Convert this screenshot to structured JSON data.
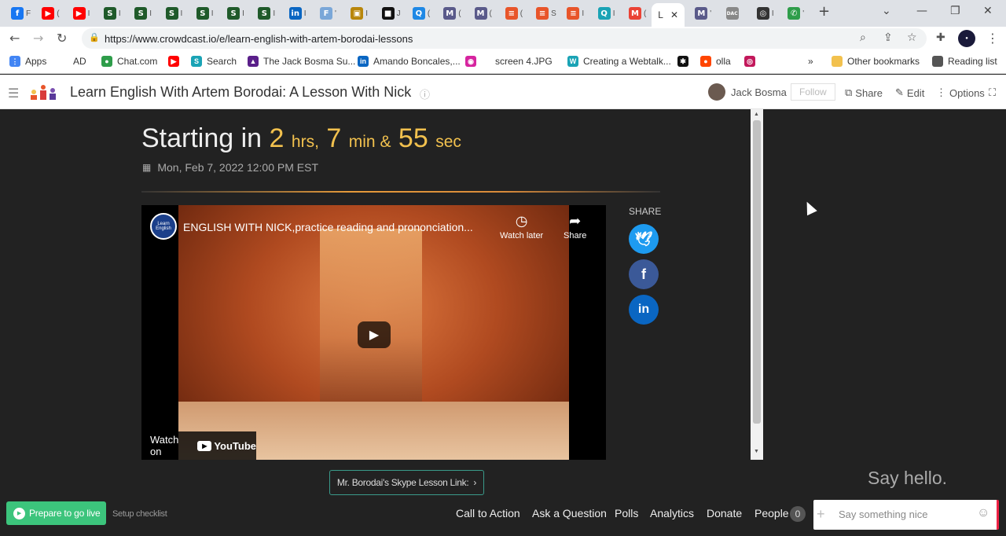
{
  "browser": {
    "tabs": [
      {
        "icon": "facebook-icon",
        "color": "#1877f2",
        "glyph": "f",
        "label": "F"
      },
      {
        "icon": "youtube-icon",
        "color": "#ff0000",
        "glyph": "▶",
        "label": "("
      },
      {
        "icon": "youtube-icon",
        "color": "#ff0000",
        "glyph": "▶",
        "label": "I"
      },
      {
        "icon": "app-icon",
        "color": "#1f5a2a",
        "glyph": "S",
        "label": "I"
      },
      {
        "icon": "app-icon",
        "color": "#1f5a2a",
        "glyph": "S",
        "label": "I"
      },
      {
        "icon": "app-icon",
        "color": "#1f5a2a",
        "glyph": "S",
        "label": "I"
      },
      {
        "icon": "app-icon",
        "color": "#1f5a2a",
        "glyph": "S",
        "label": "I"
      },
      {
        "icon": "app-icon",
        "color": "#1f5a2a",
        "glyph": "S",
        "label": "I"
      },
      {
        "icon": "app-icon",
        "color": "#1f5a2a",
        "glyph": "S",
        "label": "I"
      },
      {
        "icon": "linkedin-icon",
        "color": "#0a66c2",
        "glyph": "in",
        "label": "I"
      },
      {
        "icon": "app-icon",
        "color": "#7aa7d8",
        "glyph": "F",
        "label": "'"
      },
      {
        "icon": "app-icon",
        "color": "#b8860b",
        "glyph": "▣",
        "label": "I"
      },
      {
        "icon": "app-icon",
        "color": "#111111",
        "glyph": "■",
        "label": "J"
      },
      {
        "icon": "app-icon",
        "color": "#1e88e5",
        "glyph": "Q",
        "label": "("
      },
      {
        "icon": "app-icon",
        "color": "#5a5a8a",
        "glyph": "M",
        "label": "("
      },
      {
        "icon": "app-icon",
        "color": "#5a5a8a",
        "glyph": "M",
        "label": "("
      },
      {
        "icon": "crowdcast-icon",
        "color": "#e8552a",
        "glyph": "≡",
        "label": "("
      },
      {
        "icon": "crowdcast-icon",
        "color": "#e8552a",
        "glyph": "≡",
        "label": "S"
      },
      {
        "icon": "crowdcast-icon",
        "color": "#e8552a",
        "glyph": "≡",
        "label": "I"
      },
      {
        "icon": "app-icon",
        "color": "#1aa3b5",
        "glyph": "Q",
        "label": "I"
      },
      {
        "icon": "gmail-icon",
        "color": "#ea4335",
        "glyph": "M",
        "label": "("
      }
    ],
    "active_tab": {
      "label": "L",
      "close": "✕"
    },
    "tabs_after": [
      {
        "icon": "app-icon",
        "color": "#5a5a8a",
        "glyph": "M",
        "label": "'"
      },
      {
        "icon": "app-icon",
        "color": "#888888",
        "glyph": "DAC",
        "label": ""
      },
      {
        "icon": "app-icon",
        "color": "#333333",
        "glyph": "◎",
        "label": "I"
      },
      {
        "icon": "phone-icon",
        "color": "#2e9d4a",
        "glyph": "✆",
        "label": "'"
      }
    ],
    "new_tab": "+",
    "url": "https://www.crowdcast.io/e/learn-english-with-artem-borodai-lessons"
  },
  "bookmarks": {
    "items": [
      {
        "icon": "apps-icon",
        "color": "#4285f4",
        "glyph": "⋮",
        "label": "Apps"
      },
      {
        "icon": "bookmark-icon",
        "color": "#ffffff",
        "glyph": "",
        "label": "AD"
      },
      {
        "icon": "chat-icon",
        "color": "#2e9d4a",
        "glyph": "●",
        "label": "Chat.com"
      },
      {
        "icon": "youtube-icon",
        "color": "#ff0000",
        "glyph": "▶",
        "label": ""
      },
      {
        "icon": "search-icon",
        "color": "#1aa3b5",
        "glyph": "S",
        "label": "Search"
      },
      {
        "icon": "bookmark-icon",
        "color": "#5a1f8a",
        "glyph": "▲",
        "label": "The Jack Bosma Su..."
      },
      {
        "icon": "linkedin-icon",
        "color": "#0a66c2",
        "glyph": "in",
        "label": "Amando Boncales,..."
      },
      {
        "icon": "instagram-icon",
        "color": "#d6249f",
        "glyph": "◉",
        "label": ""
      },
      {
        "icon": "bookmark-icon",
        "color": "#ffffff",
        "glyph": "",
        "label": "screen 4.JPG"
      },
      {
        "icon": "app-icon",
        "color": "#1aa3b5",
        "glyph": "W",
        "label": "Creating a Webtalk..."
      },
      {
        "icon": "app-icon",
        "color": "#111111",
        "glyph": "✱",
        "label": ""
      },
      {
        "icon": "reddit-icon",
        "color": "#ff4500",
        "glyph": "●",
        "label": "olla"
      },
      {
        "icon": "app-icon",
        "color": "#c2185b",
        "glyph": "◎",
        "label": ""
      }
    ],
    "more": "»",
    "other": "Other bookmarks",
    "reading": "Reading list"
  },
  "header": {
    "title": "Learn English With Artem Borodai: A Lesson With Nick",
    "host": "Jack Bosma",
    "follow": "Follow",
    "share": "Share",
    "edit": "Edit",
    "options": "Options"
  },
  "countdown": {
    "prefix": "Starting in",
    "hours": "2",
    "hours_unit": "hrs,",
    "minutes": "7",
    "minutes_unit": "min &",
    "seconds": "55",
    "seconds_unit": "sec"
  },
  "event_date": "Mon, Feb 7, 2022 12:00 PM EST",
  "video": {
    "title": "ENGLISH WITH NICK,practice reading and prononciation...",
    "channel_badge": "Learn English",
    "watch_later": "Watch later",
    "share": "Share",
    "watch_on": "Watch on",
    "youtube": "YouTube"
  },
  "share_panel": {
    "label": "SHARE"
  },
  "skype_link": "Mr. Borodai's Skype Lesson Link:",
  "say_hello": "Say hello.",
  "bottom": {
    "go_live": "Prepare to go live",
    "setup": "Setup checklist",
    "tools": [
      "Call to Action",
      "Ask a Question",
      "Polls",
      "Analytics",
      "Donate",
      "People"
    ],
    "people_count": "0",
    "chat_placeholder": "Say something nice"
  }
}
